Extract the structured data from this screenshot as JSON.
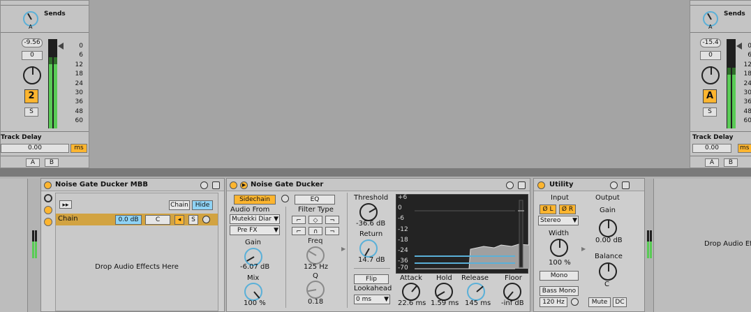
{
  "left_strip": {
    "sends_label": "Sends",
    "send_knob_label": "A",
    "volume": "-9.56",
    "pan": "0",
    "track_number": "2",
    "solo": "S",
    "track_delay_label": "Track Delay",
    "track_delay_value": "0.00",
    "delay_unit": "ms",
    "send_a": "A",
    "send_b": "B",
    "meter_level": 0.72
  },
  "right_strip": {
    "sends_label": "Sends",
    "send_knob_label": "A",
    "volume": "-15.4",
    "pan": "0",
    "track_letter": "A",
    "solo": "S",
    "track_delay_label": "Track Delay",
    "track_delay_value": "0.00",
    "delay_unit": "ms",
    "send_a": "A",
    "send_b": "B",
    "meter_level": 0.6
  },
  "scale": [
    "0",
    "6",
    "12",
    "18",
    "24",
    "30",
    "36",
    "48",
    "60"
  ],
  "mbb": {
    "title": "Noise Gate Ducker MBB",
    "chain_btn": "Chain",
    "hide_btn": "Hide",
    "chain_name": "Chain",
    "chain_vol": "0.0 dB",
    "chain_pan": "C",
    "solo": "S",
    "drop_text": "Drop Audio Effects Here"
  },
  "ducker": {
    "title": "Noise Gate Ducker",
    "sidechain_btn": "Sidechain",
    "eq_btn": "EQ",
    "audio_from_label": "Audio From",
    "audio_from_value": "Mutekki Diar",
    "pre_fx_value": "Pre FX",
    "filter_type_label": "Filter Type",
    "gain_label": "Gain",
    "gain_value": "-6.07 dB",
    "mix_label": "Mix",
    "mix_value": "100 %",
    "freq_label": "Freq",
    "freq_value": "125 Hz",
    "q_label": "Q",
    "q_value": "0.18",
    "threshold_label": "Threshold",
    "threshold_value": "-36.6 dB",
    "return_label": "Return",
    "return_value": "14.7 dB",
    "flip_btn": "Flip",
    "lookahead_label": "Lookahead",
    "lookahead_value": "0 ms",
    "attack_label": "Attack",
    "attack_value": "22.6 ms",
    "hold_label": "Hold",
    "hold_value": "1.59 ms",
    "release_label": "Release",
    "release_value": "145 ms",
    "floor_label": "Floor",
    "floor_value": "-inf dB",
    "graph_scale": [
      "+6",
      "0",
      "-6",
      "-12",
      "-18",
      "-24",
      "-36",
      "-70"
    ]
  },
  "utility": {
    "title": "Utility",
    "input_label": "Input",
    "output_label": "Output",
    "phase_l": "Ø L",
    "phase_r": "Ø R",
    "channel_mode": "Stereo",
    "width_label": "Width",
    "width_value": "100 %",
    "mono_btn": "Mono",
    "bass_mono_btn": "Bass Mono",
    "bass_freq": "120 Hz",
    "gain_label": "Gain",
    "gain_value": "0.00 dB",
    "balance_label": "Balance",
    "balance_value": "C",
    "mute_btn": "Mute",
    "dc_btn": "DC"
  },
  "right_drop_text": "Drop Audio Ef"
}
